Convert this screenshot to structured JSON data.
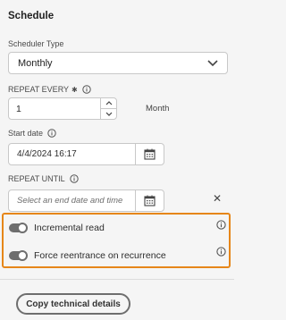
{
  "section": {
    "title": "Schedule"
  },
  "scheduler_type": {
    "label": "Scheduler Type",
    "value": "Monthly"
  },
  "repeat_every": {
    "label": "REPEAT EVERY",
    "required_mark": "✱",
    "value": "1",
    "unit": "Month"
  },
  "start_date": {
    "label": "Start date",
    "value": "4/4/2024 16:17"
  },
  "repeat_until": {
    "label": "REPEAT UNTIL",
    "placeholder": "Select an end date and time",
    "clear_glyph": "✕"
  },
  "toggles": {
    "incremental_read": {
      "label": "Incremental read",
      "state": "on"
    },
    "force_reentrance": {
      "label": "Force reentrance on recurrence",
      "state": "on"
    }
  },
  "actions": {
    "copy_label": "Copy technical details"
  },
  "colors": {
    "highlight": "#e68619",
    "background": "#f5f5f5"
  },
  "icons": [
    "info-icon",
    "chevron-down-icon",
    "calendar-icon",
    "close-icon",
    "chevron-up-icon"
  ]
}
